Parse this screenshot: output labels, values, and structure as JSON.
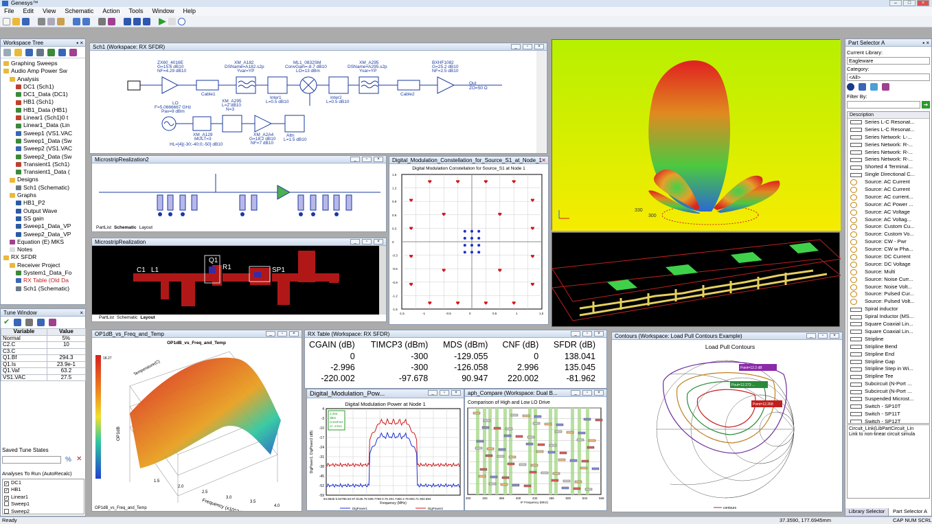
{
  "app": {
    "title": "Genesys™"
  },
  "menu": [
    "File",
    "Edit",
    "View",
    "Schematic",
    "Action",
    "Tools",
    "Window",
    "Help"
  ],
  "workspace_tree": {
    "title": "Workspace Tree",
    "items": [
      {
        "label": "Graphing Sweeps",
        "indent": 0,
        "icon": "folder-icon"
      },
      {
        "label": "Audio Amp Power Sw",
        "indent": 0,
        "icon": "folder-icon"
      },
      {
        "label": "Analysis",
        "indent": 1,
        "icon": "folder-icon"
      },
      {
        "label": "DC1 (Sch1)",
        "indent": 2,
        "icon": "analysis-icon"
      },
      {
        "label": "DC1_Data (DC1)",
        "indent": 2,
        "icon": "dataset-icon"
      },
      {
        "label": "HB1 (Sch1)",
        "indent": 2,
        "icon": "analysis-icon"
      },
      {
        "label": "HB1_Data (HB1)",
        "indent": 2,
        "icon": "dataset-icon"
      },
      {
        "label": "Linear1 (Sch1)0 t",
        "indent": 2,
        "icon": "analysis-icon"
      },
      {
        "label": "Linear1_Data (Lin",
        "indent": 2,
        "icon": "dataset-icon"
      },
      {
        "label": "Sweep1 (VS1.VAC",
        "indent": 2,
        "icon": "sweep-icon"
      },
      {
        "label": "Sweep1_Data (Sw",
        "indent": 2,
        "icon": "dataset-icon"
      },
      {
        "label": "Sweep2 (VS1.VAC",
        "indent": 2,
        "icon": "sweep-icon"
      },
      {
        "label": "Sweep2_Data (Sw",
        "indent": 2,
        "icon": "dataset-icon"
      },
      {
        "label": "Transient1 (Sch1)",
        "indent": 2,
        "icon": "analysis-icon"
      },
      {
        "label": "Transient1_Data (",
        "indent": 2,
        "icon": "dataset-icon"
      },
      {
        "label": "Designs",
        "indent": 1,
        "icon": "folder-icon"
      },
      {
        "label": "Sch1 (Schematic)",
        "indent": 2,
        "icon": "schematic-icon"
      },
      {
        "label": "Graphs",
        "indent": 1,
        "icon": "folder-icon"
      },
      {
        "label": "HB1_P2",
        "indent": 2,
        "icon": "graph-icon"
      },
      {
        "label": "Output Wave",
        "indent": 2,
        "icon": "graph-icon"
      },
      {
        "label": "SS gain",
        "indent": 2,
        "icon": "graph-icon"
      },
      {
        "label": "Sweep1_Data_VP",
        "indent": 2,
        "icon": "graph-icon"
      },
      {
        "label": "Sweep2_Data_VP",
        "indent": 2,
        "icon": "graph-icon"
      },
      {
        "label": "Equation (E) MKS",
        "indent": 1,
        "icon": "equation-icon"
      },
      {
        "label": "Notes",
        "indent": 1,
        "icon": "notes-icon"
      },
      {
        "label": "RX SFDR",
        "indent": 0,
        "icon": "folder-icon"
      },
      {
        "label": "Receiver Project",
        "indent": 1,
        "icon": "folder-icon"
      },
      {
        "label": "System1_Data_Fo",
        "indent": 2,
        "icon": "dataset-icon"
      },
      {
        "label": "RX Table (Old Da",
        "indent": 2,
        "icon": "table-icon"
      },
      {
        "label": "Sch1 (Schematic)",
        "indent": 2,
        "icon": "schematic-icon"
      }
    ]
  },
  "tune_window": {
    "title": "Tune Window",
    "headers": [
      "Variable",
      "Value"
    ],
    "rows": [
      [
        "Normal",
        "5%"
      ],
      [
        "C2.C",
        "10"
      ],
      [
        "C3.C",
        ""
      ],
      [
        "Q1.Bf",
        "294.3"
      ],
      [
        "Q1.Is",
        "23.9e-1"
      ],
      [
        "Q1.Vaf",
        "63.2"
      ],
      [
        "VS1.VAC",
        "27.5"
      ]
    ],
    "saved_label": "Saved Tune States",
    "analyses_label": "Analyses To Run (AutoRecalc)",
    "analyses": [
      "DC1",
      "HB1",
      "Linear1",
      "Sweep1",
      "Sweep2"
    ]
  },
  "schematic": {
    "title": "Sch1 (Workspace: RX SFDR)",
    "labels": {
      "zx": "ZX60_4016E",
      "zx_g": "G=15.6 dB10",
      "zx_nf": "NF=4.29 dB10",
      "xma182": "XM_A182",
      "xma182_ds": "DSName=A182.s2p",
      "xma182_y": "Yvar=YP",
      "ml": "ML1_0832SM",
      "ml_cg": "ConvGain=-8.7 dB10",
      "ml_lo": "LO=13 dBm",
      "xma295": "XM_A295",
      "xma295_ds": "DSName=A295.s2p",
      "xma295_y": "Yvar=YP",
      "bxhf": "BXHF1082",
      "bxhf_g": "G=25.2 dB10",
      "bxhf_nf": "NF=2.5 dB10",
      "cable1": "Cable1",
      "inter1": "Inter1",
      "inter1_l": "L=0.5 dB10",
      "inter2": "Inter2",
      "inter2_l": "L=0.5 dB10",
      "cable2": "Cable2",
      "out": "Out",
      "out_z": "ZO=50 Ω",
      "lo": "LO",
      "lo_f": "F=5.0666667 GHz",
      "lo_p": "Pav=9 dBm",
      "xma295b": "XM_A295",
      "xma295b_l": "L=2 dB10",
      "n3": "N=3",
      "xma129": "XM_A129",
      "mult": "MULT=3",
      "hl": "HL=[4](-30;-40;0;-50] dB10",
      "xma2a4": "XM_A2A4",
      "xma2a4_g": "G=18.2 dB10",
      "xma2a4_nf": "NF=7 dB10",
      "attn": "Attn",
      "attn_l": "L=1.5 dB10"
    }
  },
  "microstrip2": {
    "title": "MicrostripRealization2",
    "tabs": [
      "PartList",
      "Schematic",
      "Layout"
    ]
  },
  "microstrip": {
    "title": "MicrostripRealization",
    "tabs": [
      "PartList",
      "Schematic",
      "Layout"
    ],
    "labels": [
      "C1",
      "L1",
      "Q1",
      "R1",
      "SP1"
    ]
  },
  "constellation": {
    "title": "Digital_Modulation_Constellation_for_Source_S1_at_Node_1",
    "plot_title": "Digital Modulation Constellation for Source_S1 at Node 1",
    "yticks": [
      "1.5",
      "1.2",
      "0.9",
      "0.6",
      "0.3",
      "0",
      "-0.3",
      "-0.6",
      "-0.9",
      "-1.2",
      "-1.5"
    ],
    "xticks": [
      "-1.5",
      "-1",
      "-0.5",
      "0",
      "0.5",
      "1",
      "1.5"
    ]
  },
  "surface": {
    "title": "OP1dB_vs_Freq_and_Temp",
    "plot_title": "OP1dB_vs_Freq_and_Temp",
    "xlabel": "Frequency (x10^3 MHz)",
    "zlabel": "OP1dB",
    "temp_label": "Temperature(C)",
    "colorbar_ticks": [
      "18.27",
      "",
      "",
      "",
      "",
      "",
      "",
      "",
      "",
      "",
      ""
    ],
    "footer": "OP1dB_vs_Freq_and_Temp",
    "xticks": [
      "1.5",
      "2.0",
      "2.5",
      "3.0",
      "3.5",
      "4.0"
    ]
  },
  "rx_table": {
    "title": "RX Table (Workspace: RX SFDR)",
    "headers": [
      "CGAIN (dB)",
      "TIMCP3 (dBm)",
      "MDS (dBm)",
      "CNF (dB)",
      "SFDR (dB)"
    ],
    "rows": [
      [
        "0",
        "-300",
        "-129.055",
        "0",
        "138.041"
      ],
      [
        "-2.996",
        "-300",
        "-126.058",
        "2.996",
        "135.045"
      ],
      [
        "-220.002",
        "-97.678",
        "90.947",
        "220.002",
        "-81.962"
      ]
    ]
  },
  "dig_power": {
    "title": "Digital_Modulation_Pow...",
    "plot_title": "Digital Modulation Power at Node 1",
    "ylabel": "DigPower1, DigPower2 (dB)",
    "xlabel": "Frequency (MHz)",
    "yticks": [
      "4",
      "-3",
      "-10",
      "-17",
      "-24",
      "-31",
      "-38",
      "-45",
      "-52",
      "-59"
    ],
    "marker": [
      "2.393",
      "dBm",
      "CrestFact",
      "or: 4.914"
    ],
    "xticks_text": "94.9546 5.94796.93 97.9136.79 599.7768 0.76 201.7465 2.78 803.71 904.694",
    "legend": [
      "DigPower1",
      "DigPower2"
    ]
  },
  "graph_compare": {
    "title": "aph_Compare (Workspace: Dual B...",
    "plot_title": "Comparison of High and Low LO Drive",
    "xlabel": "IF Frequency (MHz)",
    "xticks": [
      "300",
      "334",
      "368",
      "400",
      "432",
      "466",
      "500",
      "534",
      "568"
    ]
  },
  "contours": {
    "title": "Contours (Workspace: Load Pull Contours Example)",
    "plot_title": "Load Pull Contours",
    "legend": "contours",
    "markers": [
      "Point=12.2 dB",
      "Pout=12.273 ...",
      "Point=12.268"
    ]
  },
  "part_selector": {
    "title": "Part Selector A",
    "current_library_label": "Current Library:",
    "library": "Eagleware",
    "category_label": "Category:",
    "category": "<All>",
    "filter_label": "Filter By:",
    "desc_header": "Description",
    "parts": [
      "Series L-C Resonat...",
      "Series L-C Resonat...",
      "Series Network: L-...",
      "Series Network: R-...",
      "Series Network: R-...",
      "Series Network: R-...",
      "Shorted 4 Terminal...",
      "Single Directional C...",
      "Source: AC Current",
      "Source: AC Current",
      "Source: AC current...",
      "Source: AC Power ...",
      "Source: AC Voltage",
      "Source: AC Voltag...",
      "Source: Custom Cu...",
      "Source: Custom Vo...",
      "Source: CW - Pwr",
      "Source: CW w Pha...",
      "Source: DC Current",
      "Source: DC Voltage",
      "Source: Multi",
      "Source: Noise Curr...",
      "Source: Noise Volt...",
      "Source: Pulsed Cur...",
      "Source: Pulsed Volt...",
      "Spiral inductor",
      "Spiral Inductor (MS...",
      "Square Coaxial Lin...",
      "Square Coaxial Lin...",
      "Stripline",
      "Stripline Bend",
      "Stripline End",
      "Stripline Gap",
      "Stripline Step in Wi...",
      "Stripline Tee",
      "Subcircuit (N-Port ...",
      "Subcircuit (N-Port ...",
      "Suspended Microst...",
      "Switch - SP10T",
      "Switch - SP11T",
      "Switch - SP12T"
    ],
    "tooltip": [
      "Circuit_Link(LibPartCircuit_Lin",
      "Link to non-linear circuit simula"
    ],
    "tabs": [
      "Library Selector",
      "Part Selector A"
    ]
  },
  "status": {
    "left": "Ready",
    "coords": "37.3590, 177.6945mm",
    "keys": "CAP NUM SCRL"
  }
}
